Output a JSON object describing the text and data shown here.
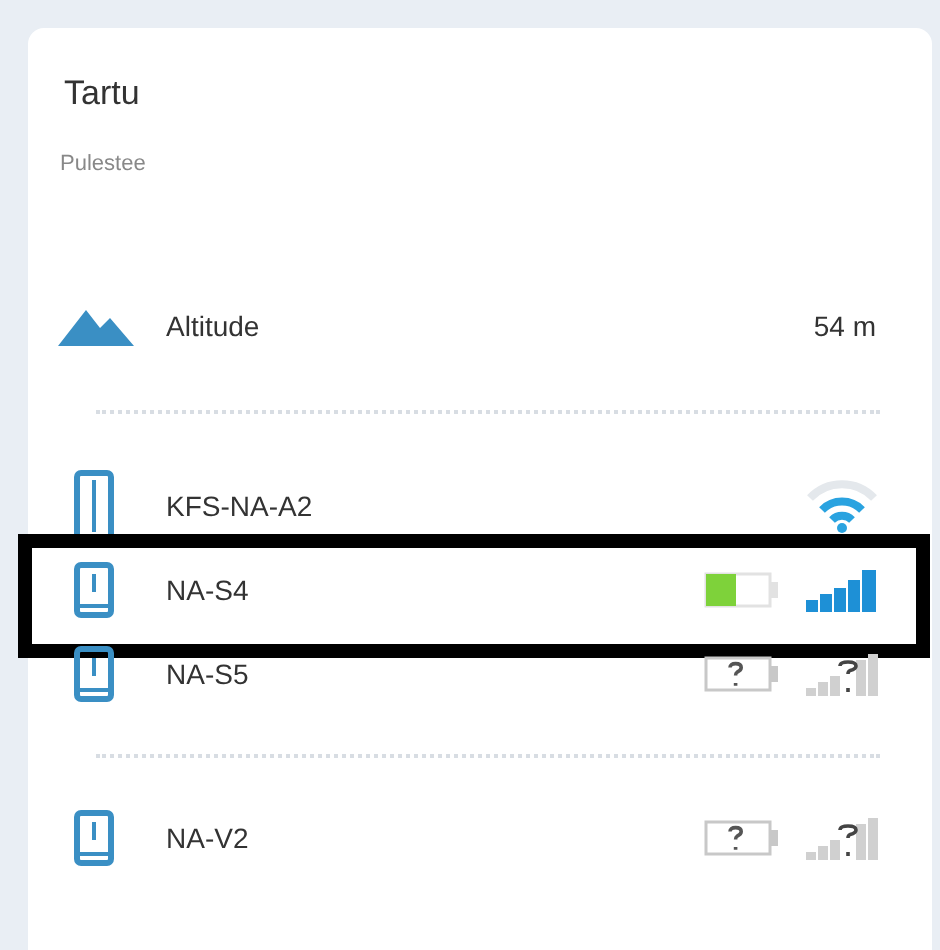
{
  "location": {
    "title": "Tartu",
    "subtitle": "Pulestee"
  },
  "altitude": {
    "label": "Altitude",
    "value": "54 m"
  },
  "device_groups": [
    {
      "devices": [
        {
          "name": "KFS-NA-A2",
          "kind": "gateway",
          "highlighted": false
        },
        {
          "name": "NA-S4",
          "kind": "sensor",
          "online": true,
          "highlighted": true
        },
        {
          "name": "NA-S5",
          "kind": "sensor",
          "online": false,
          "highlighted": false
        }
      ]
    },
    {
      "devices": [
        {
          "name": "NA-V2",
          "kind": "sensor",
          "online": false,
          "highlighted": false
        }
      ]
    }
  ]
}
